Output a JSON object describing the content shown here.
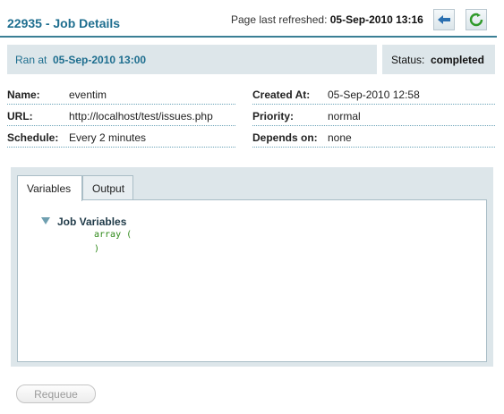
{
  "header": {
    "title": "22935 - Job Details",
    "refresh_label": "Page last refreshed:",
    "refresh_time": "05-Sep-2010 13:16",
    "back_icon": "arrow-left-icon",
    "reload_icon": "reload-icon"
  },
  "run": {
    "label": "Ran at",
    "value": "05-Sep-2010 13:00"
  },
  "status": {
    "label": "Status:",
    "value": "completed"
  },
  "details_left": [
    {
      "key": "Name:",
      "value": "eventim"
    },
    {
      "key": "URL:",
      "value": "http://localhost/test/issues.php"
    },
    {
      "key": "Schedule:",
      "value": "Every 2 minutes"
    }
  ],
  "details_right": [
    {
      "key": "Created At:",
      "value": "05-Sep-2010 12:58"
    },
    {
      "key": "Priority:",
      "value": "normal"
    },
    {
      "key": "Depends on:",
      "value": "none"
    }
  ],
  "tabs": [
    {
      "label": "Variables",
      "active": true
    },
    {
      "label": "Output",
      "active": false
    }
  ],
  "variables": {
    "section_title": "Job Variables",
    "code_lines": [
      "array (",
      ")"
    ]
  },
  "requeue_label": "Requeue",
  "colors": {
    "accent": "#1e6e8f",
    "panel": "#dde6ea",
    "code": "#2f8a1a"
  }
}
